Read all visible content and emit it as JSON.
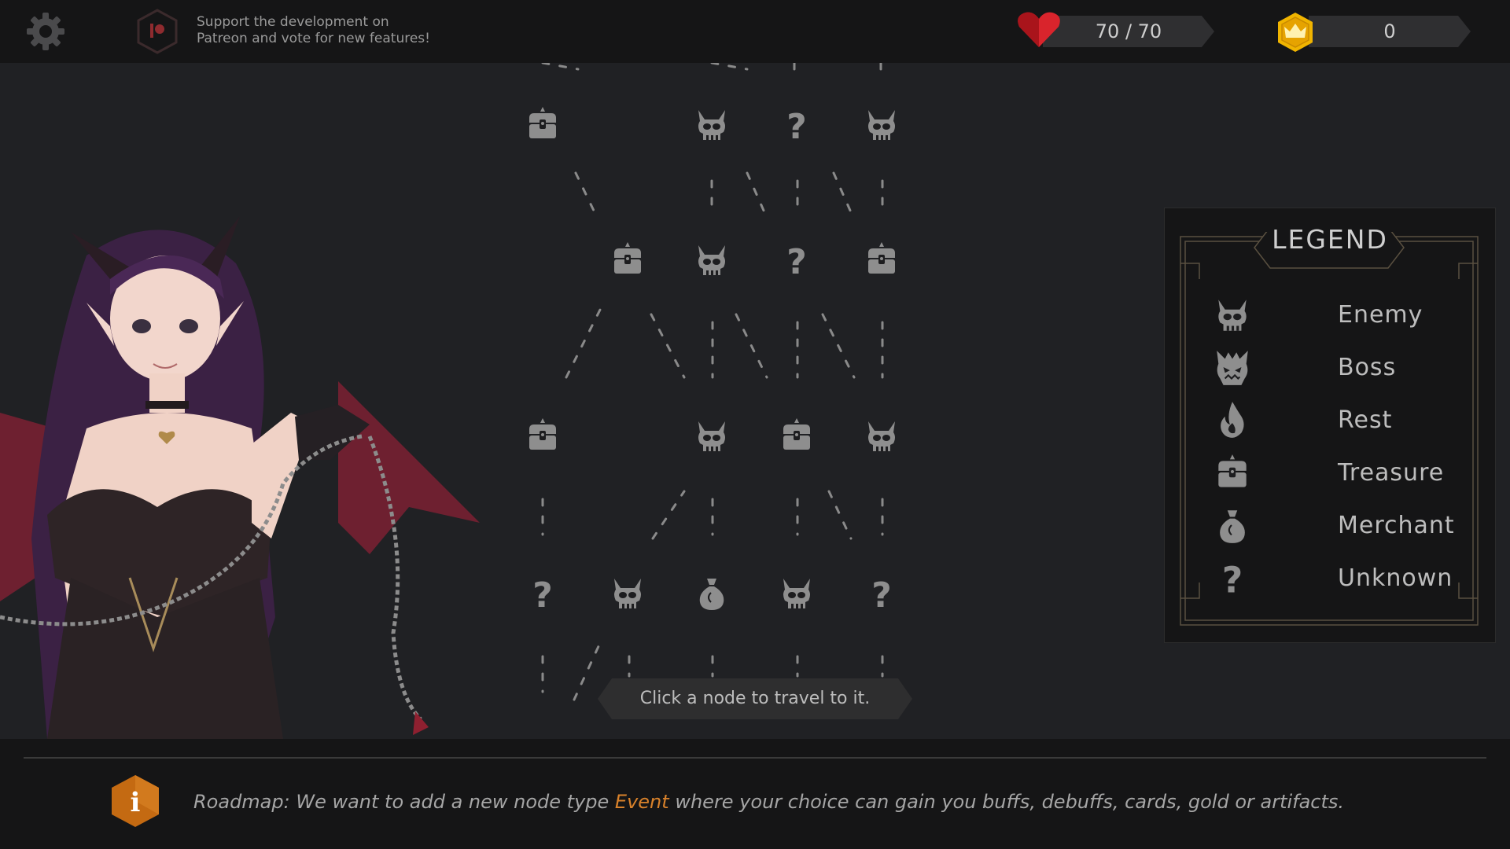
{
  "topbar": {
    "settings_icon": "gear-icon",
    "patreon": {
      "icon": "patreon-icon",
      "line1": "Support the development on",
      "line2": "Patreon and vote for new features!"
    },
    "health": {
      "icon": "heart-icon",
      "current": 70,
      "max": 70,
      "text": "70 / 70",
      "color": "#d9242c"
    },
    "gold": {
      "icon": "crown-coin-icon",
      "text": "0",
      "color": "#f0b400"
    }
  },
  "map": {
    "rows": [
      {
        "row": 1,
        "nodes": [
          "treasure",
          "enemy",
          "unknown",
          "enemy"
        ]
      },
      {
        "row": 2,
        "nodes": [
          "treasure",
          "enemy",
          "unknown",
          "treasure"
        ]
      },
      {
        "row": 3,
        "nodes": [
          "treasure",
          "enemy",
          "treasure",
          "enemy"
        ]
      },
      {
        "row": 4,
        "nodes": [
          "unknown",
          "enemy",
          "merchant",
          "enemy",
          "unknown"
        ]
      }
    ]
  },
  "legend": {
    "title": "LEGEND",
    "items": [
      {
        "icon": "enemy-icon",
        "label": "Enemy"
      },
      {
        "icon": "boss-icon",
        "label": "Boss"
      },
      {
        "icon": "rest-icon",
        "label": "Rest"
      },
      {
        "icon": "treasure-icon",
        "label": "Treasure"
      },
      {
        "icon": "merchant-icon",
        "label": "Merchant"
      },
      {
        "icon": "unknown-icon",
        "label": "Unknown"
      }
    ]
  },
  "hint": "Click a node to travel to it.",
  "footer": {
    "info_icon": "info-icon",
    "roadmap_before": "Roadmap: We want to add a new node type ",
    "roadmap_highlight": "Event",
    "roadmap_after": " where your choice can gain you buffs, debuffs, cards, gold or artifacts.",
    "highlight_color": "#d9822b"
  }
}
